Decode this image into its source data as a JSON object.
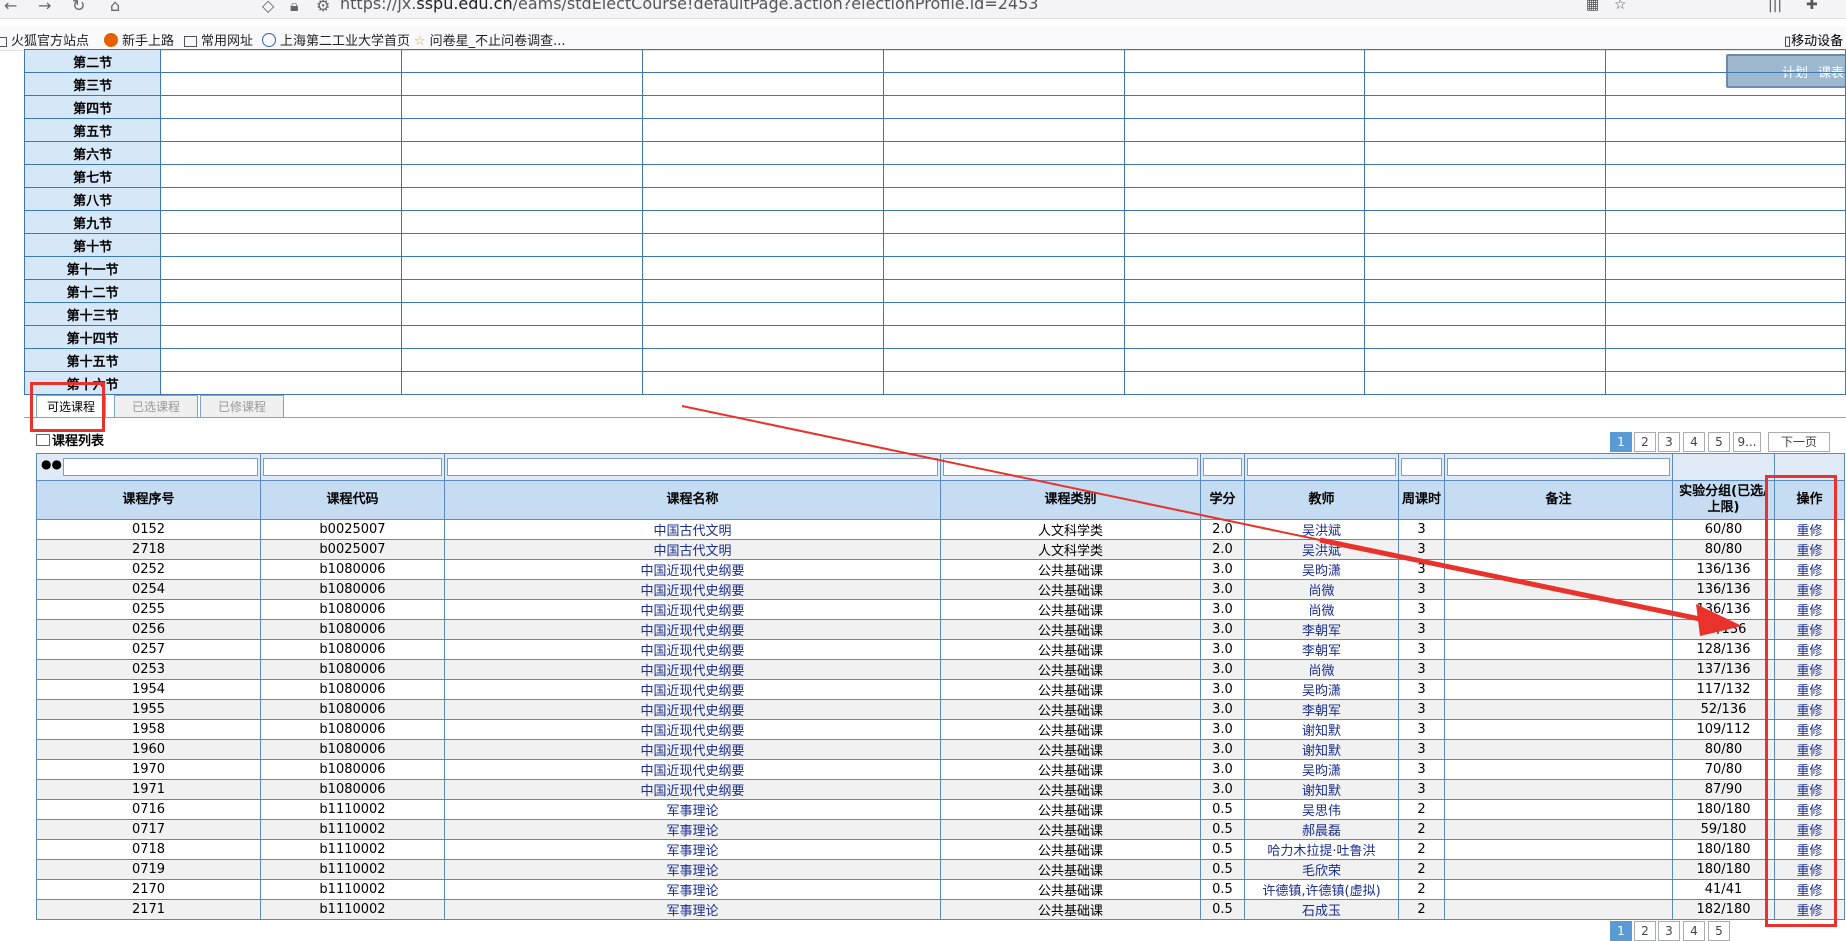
{
  "browser": {
    "url_prefix": "https://jx.",
    "url_domain": "sspu.edu.cn",
    "url_rest": "/eams/stdElectCourse!defaultPage.action?electionProfile.id=2453",
    "bookmarks": [
      "火狐官方站点",
      "新手上路",
      "常用网址",
      "上海第二工业大学首页",
      "问卷星_不止问卷调查..."
    ],
    "mobile_bookmarks": "移动设备"
  },
  "float_widget": {
    "plan": "计划",
    "timetable": "课表"
  },
  "timetable": {
    "slots": [
      "第二节",
      "第三节",
      "第四节",
      "第五节",
      "第六节",
      "第七节",
      "第八节",
      "第九节",
      "第十节",
      "第十一节",
      "第十二节",
      "第十三节",
      "第十四节",
      "第十五节",
      "第十六节"
    ]
  },
  "tabs": [
    {
      "label": "可选课程",
      "active": true
    },
    {
      "label": "已选课程",
      "active": false
    },
    {
      "label": "已修课程",
      "active": false
    }
  ],
  "list_title": "课程列表",
  "pager": {
    "pages": [
      "1",
      "2",
      "3",
      "4",
      "5",
      "9..."
    ],
    "current": "1",
    "next": "下一页"
  },
  "columns": [
    "课程序号",
    "课程代码",
    "课程名称",
    "课程类别",
    "学分",
    "教师",
    "周课时",
    "备注",
    "实验分组(已选/上限)",
    "操作"
  ],
  "rows": [
    [
      "0152",
      "b0025007",
      "中国古代文明",
      "人文科学类",
      "2.0",
      "吴洪斌",
      "3",
      "",
      "60/80",
      "重修"
    ],
    [
      "2718",
      "b0025007",
      "中国古代文明",
      "人文科学类",
      "2.0",
      "吴洪斌",
      "3",
      "",
      "80/80",
      "重修"
    ],
    [
      "0252",
      "b1080006",
      "中国近现代史纲要",
      "公共基础课",
      "3.0",
      "吴昀潇",
      "3",
      "",
      "136/136",
      "重修"
    ],
    [
      "0254",
      "b1080006",
      "中国近现代史纲要",
      "公共基础课",
      "3.0",
      "尚微",
      "3",
      "",
      "136/136",
      "重修"
    ],
    [
      "0255",
      "b1080006",
      "中国近现代史纲要",
      "公共基础课",
      "3.0",
      "尚微",
      "3",
      "",
      "136/136",
      "重修"
    ],
    [
      "0256",
      "b1080006",
      "中国近现代史纲要",
      "公共基础课",
      "3.0",
      "李朝军",
      "3",
      "",
      "69/136",
      "重修"
    ],
    [
      "0257",
      "b1080006",
      "中国近现代史纲要",
      "公共基础课",
      "3.0",
      "李朝军",
      "3",
      "",
      "128/136",
      "重修"
    ],
    [
      "0253",
      "b1080006",
      "中国近现代史纲要",
      "公共基础课",
      "3.0",
      "尚微",
      "3",
      "",
      "137/136",
      "重修"
    ],
    [
      "1954",
      "b1080006",
      "中国近现代史纲要",
      "公共基础课",
      "3.0",
      "吴昀潇",
      "3",
      "",
      "117/132",
      "重修"
    ],
    [
      "1955",
      "b1080006",
      "中国近现代史纲要",
      "公共基础课",
      "3.0",
      "李朝军",
      "3",
      "",
      "52/136",
      "重修"
    ],
    [
      "1958",
      "b1080006",
      "中国近现代史纲要",
      "公共基础课",
      "3.0",
      "谢知默",
      "3",
      "",
      "109/112",
      "重修"
    ],
    [
      "1960",
      "b1080006",
      "中国近现代史纲要",
      "公共基础课",
      "3.0",
      "谢知默",
      "3",
      "",
      "80/80",
      "重修"
    ],
    [
      "1970",
      "b1080006",
      "中国近现代史纲要",
      "公共基础课",
      "3.0",
      "吴昀潇",
      "3",
      "",
      "70/80",
      "重修"
    ],
    [
      "1971",
      "b1080006",
      "中国近现代史纲要",
      "公共基础课",
      "3.0",
      "谢知默",
      "3",
      "",
      "87/90",
      "重修"
    ],
    [
      "0716",
      "b1110002",
      "军事理论",
      "公共基础课",
      "0.5",
      "吴思伟",
      "2",
      "",
      "180/180",
      "重修"
    ],
    [
      "0717",
      "b1110002",
      "军事理论",
      "公共基础课",
      "0.5",
      "郝晨磊",
      "2",
      "",
      "59/180",
      "重修"
    ],
    [
      "0718",
      "b1110002",
      "军事理论",
      "公共基础课",
      "0.5",
      "哈力木拉提·吐鲁洪",
      "2",
      "",
      "180/180",
      "重修"
    ],
    [
      "0719",
      "b1110002",
      "军事理论",
      "公共基础课",
      "0.5",
      "毛欣荣",
      "2",
      "",
      "180/180",
      "重修"
    ],
    [
      "2170",
      "b1110002",
      "军事理论",
      "公共基础课",
      "0.5",
      "许德镇,许德镇(虚拟)",
      "2",
      "",
      "41/41",
      "重修"
    ],
    [
      "2171",
      "b1110002",
      "军事理论",
      "公共基础课",
      "0.5",
      "石成玉",
      "2",
      "",
      "182/180",
      "重修"
    ]
  ],
  "colors": {
    "accent_blue": "#3c78b4",
    "header_bg": "#c5dcf3",
    "annotation_red": "#e8322b"
  }
}
